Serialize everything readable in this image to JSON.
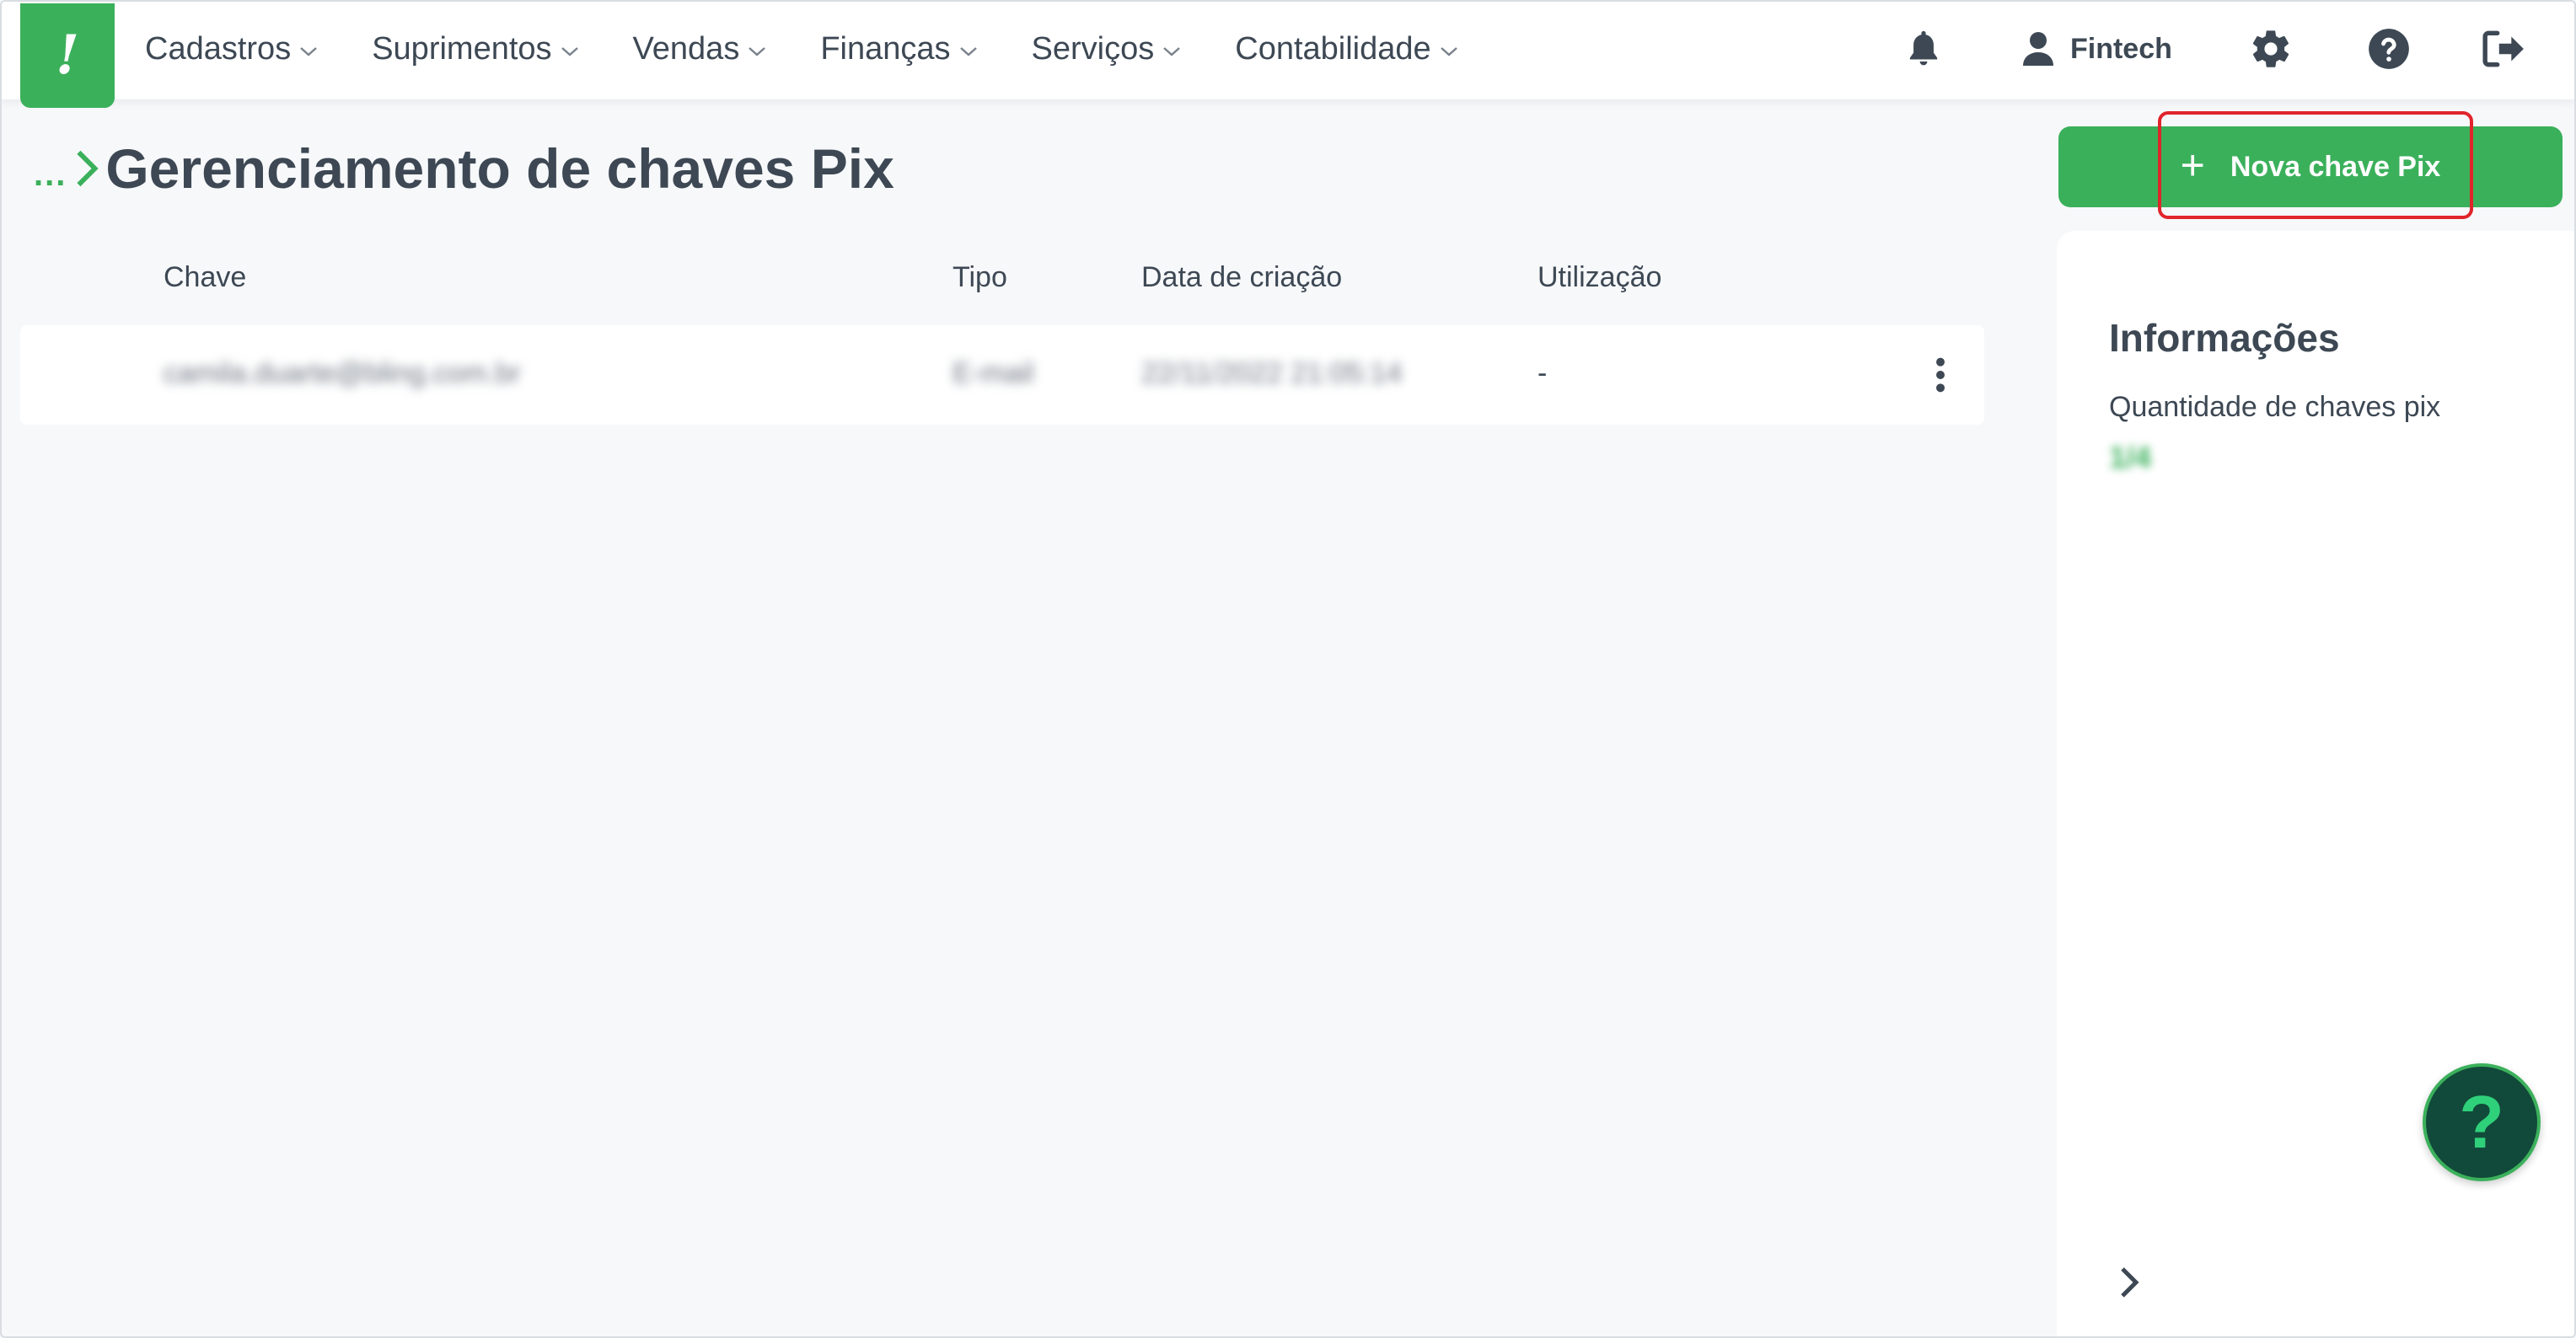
{
  "nav": {
    "logo_text": "!",
    "menu": [
      {
        "label": "Cadastros"
      },
      {
        "label": "Suprimentos"
      },
      {
        "label": "Vendas"
      },
      {
        "label": "Finanças"
      },
      {
        "label": "Serviços"
      },
      {
        "label": "Contabilidade"
      }
    ],
    "icons": [
      "bell-icon",
      "user-icon",
      "gear-icon",
      "help-circle-icon",
      "logout-icon"
    ],
    "user_label": "Fintech"
  },
  "breadcrumb": {
    "ellipsis": "...",
    "title": "Gerenciamento de chaves Pix"
  },
  "table": {
    "headers": [
      "Chave",
      "Tipo",
      "Data de criação",
      "Utilização"
    ],
    "rows": [
      {
        "chave": "camila.duarte@bling.com.br",
        "tipo": "E-mail",
        "data": "22/11/2022 21:05:14",
        "utilizacao": "-"
      }
    ]
  },
  "actions": {
    "new_key_label": "Nova chave Pix",
    "plus": "+"
  },
  "info_panel": {
    "title": "Informações",
    "count_label": "Quantidade de chaves pix",
    "count_value": "1/4"
  },
  "help_fab": "?",
  "colors": {
    "brand_green": "#3bb05b",
    "text": "#3d4854",
    "highlight_red": "#e0252b",
    "fab_dark": "#11493a"
  }
}
